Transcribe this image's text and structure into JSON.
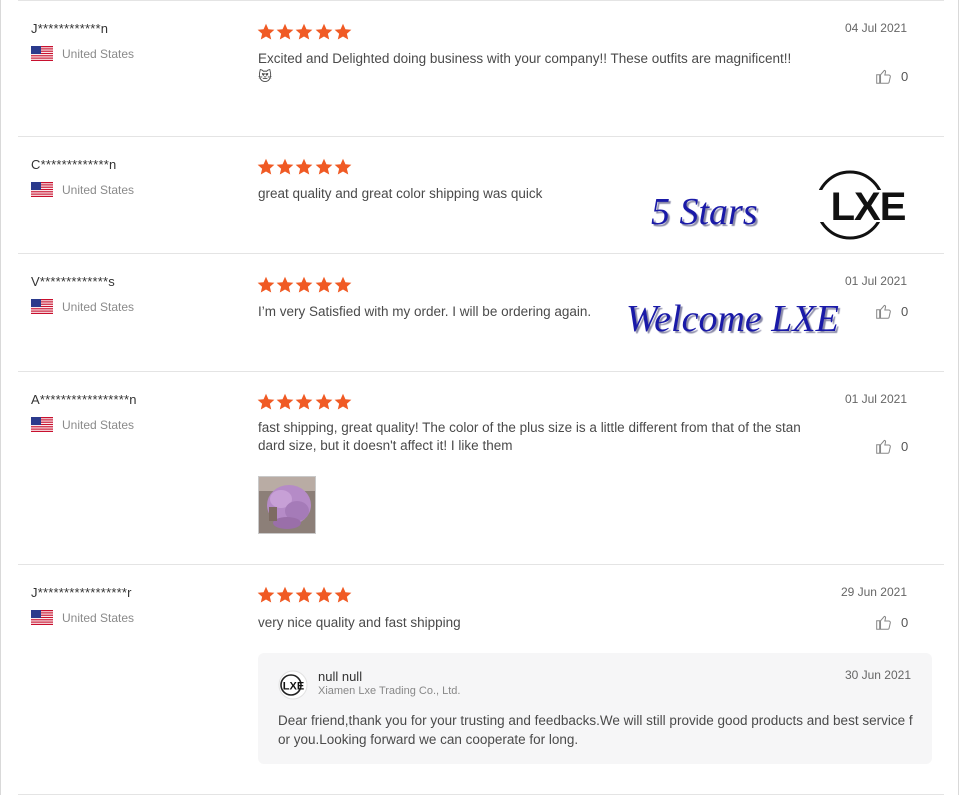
{
  "country_label": "United States",
  "colors": {
    "star": "#f05a24",
    "overlay_text": "#1a1aa8"
  },
  "reviews": [
    {
      "reviewer": "J************n",
      "country": "United States",
      "rating": 5,
      "date": "04 Jul 2021",
      "text_lines": [
        "Excited and Delighted doing business with your company!! These outfits are magnificent!!"
      ],
      "emoji": "😻",
      "likes": "0"
    },
    {
      "reviewer": "C*************n",
      "country": "United States",
      "rating": 5,
      "date": "",
      "text_lines": [
        "great quality and great color shipping was quick"
      ],
      "likes": ""
    },
    {
      "reviewer": "V*************s",
      "country": "United States",
      "rating": 5,
      "date": "01 Jul 2021",
      "text_lines": [
        "I’m very Satisfied with my order. I will be ordering again."
      ],
      "likes": "0"
    },
    {
      "reviewer": "A*****************n",
      "country": "United States",
      "rating": 5,
      "date": "01 Jul 2021",
      "text_lines": [
        "fast shipping, great quality! The color of the plus size is a little different from that of the stan",
        "dard size, but it doesn't affect it! I like them"
      ],
      "likes": "0"
    },
    {
      "reviewer": "J*****************r",
      "country": "United States",
      "rating": 5,
      "date": "29 Jun 2021",
      "text_lines": [
        "very nice quality and fast shipping"
      ],
      "likes": "0"
    }
  ],
  "reply": {
    "name": "null null",
    "company": "Xiamen Lxe Trading Co., Ltd.",
    "date": "30 Jun 2021",
    "text": "Dear friend,thank you for your trusting and feedbacks.We will still provide good products and best service for you.Looking forward we can cooperate for long."
  },
  "overlays": {
    "stars_text": "5 Stars",
    "welcome_text": "Welcome LXE",
    "logo_text": "LXE"
  }
}
